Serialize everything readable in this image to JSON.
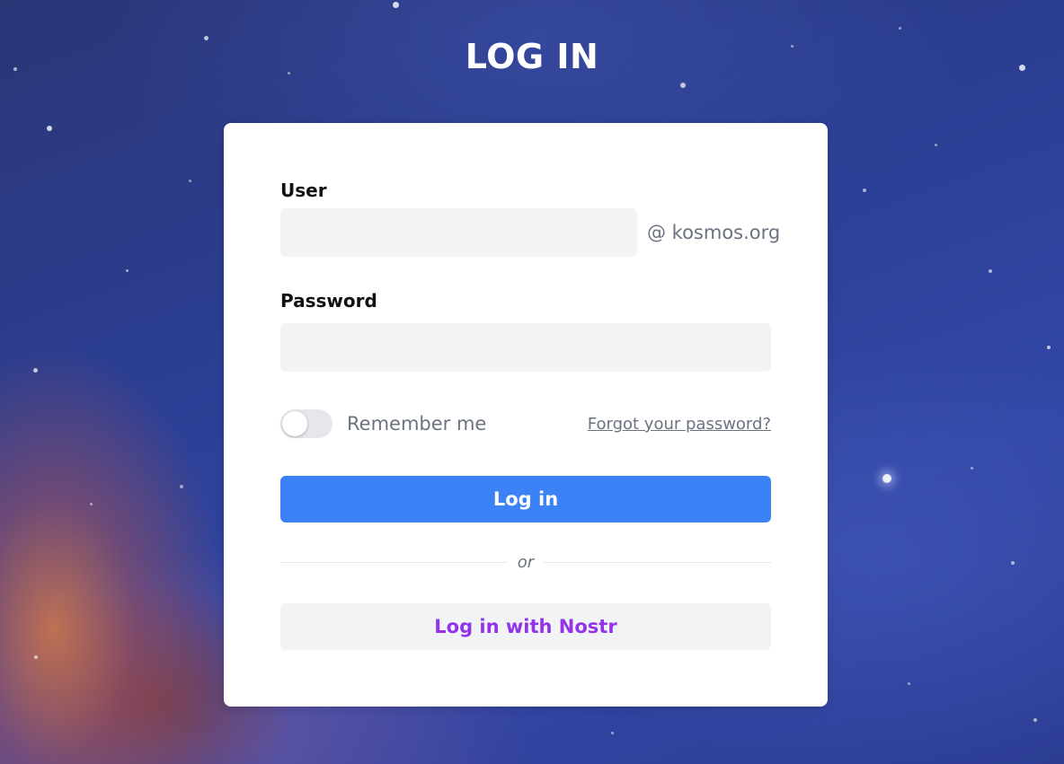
{
  "page": {
    "title": "LOG IN"
  },
  "form": {
    "user_label": "User",
    "user_value": "",
    "user_placeholder": "",
    "domain_suffix": "@ kosmos.org",
    "password_label": "Password",
    "password_value": "",
    "password_placeholder": "",
    "remember_me_label": "Remember me",
    "remember_me_checked": false,
    "forgot_password_link": "Forgot your password?",
    "login_button": "Log in",
    "divider_text": "or",
    "nostr_button": "Log in with Nostr"
  },
  "colors": {
    "primary_button": "#3b82f6",
    "nostr_text": "#9333ea",
    "muted_text": "#6b7280",
    "input_background": "#f2f3f5"
  },
  "icons": {
    "remember_toggle": "toggle-switch-off"
  }
}
